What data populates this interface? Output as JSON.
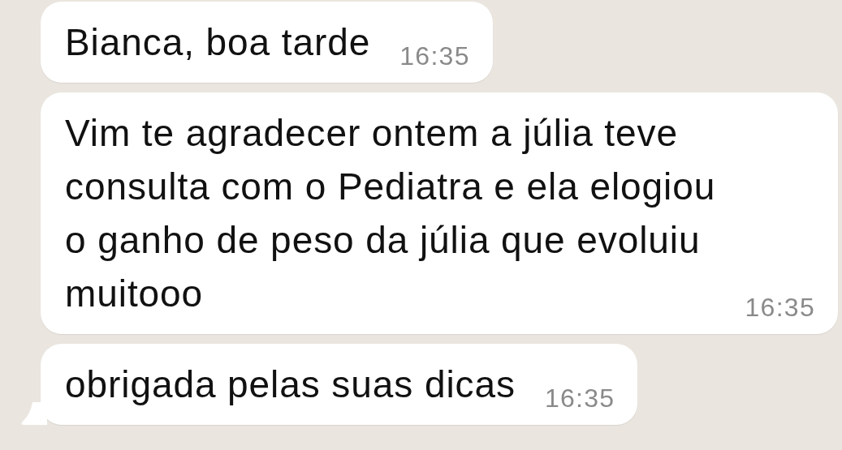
{
  "messages": [
    {
      "text": "Bianca, boa tarde",
      "time": "16:35",
      "tail": false
    },
    {
      "text": "Vim te agradecer ontem a júlia teve consulta com o Pediatra e ela elogiou o ganho de peso da júlia que evoluiu muitooo",
      "time": "16:35",
      "tail": false
    },
    {
      "text": "obrigada pelas suas dicas",
      "time": "16:35",
      "tail": true
    }
  ]
}
